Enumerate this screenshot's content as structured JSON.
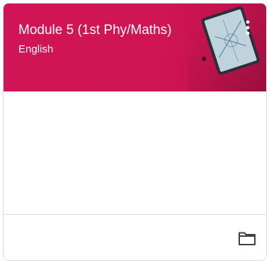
{
  "card": {
    "title": "Module 5 (1st Phy/Maths)",
    "subtitle": "English",
    "header_color": "#d01455",
    "more_icon": "more-vert-icon",
    "folder_icon": "folder-icon"
  }
}
